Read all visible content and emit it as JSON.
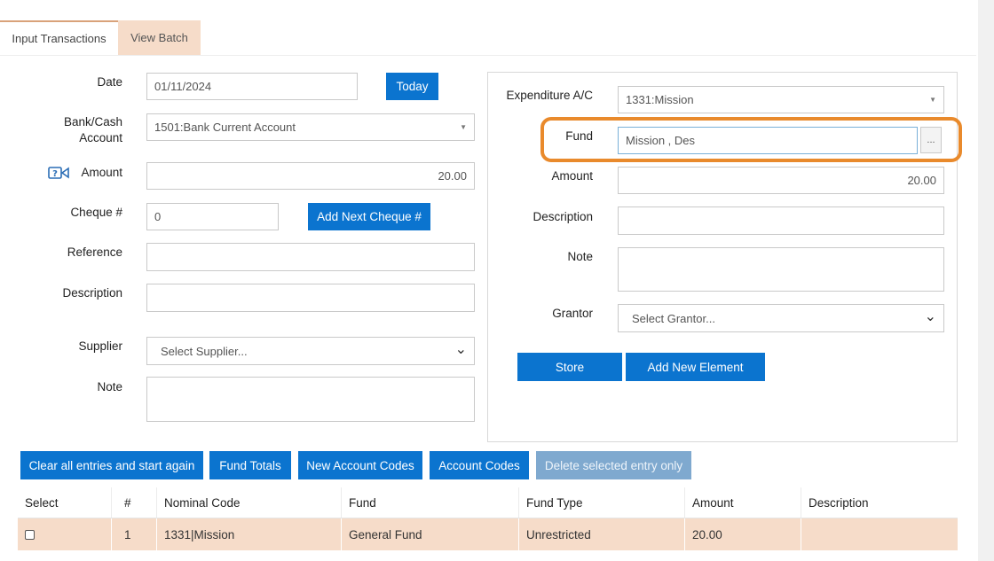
{
  "tabs": [
    {
      "label": "Input Transactions",
      "active": true
    },
    {
      "label": "View Batch",
      "active": false
    }
  ],
  "left_form": {
    "date_label": "Date",
    "date_value": "01/11/2024",
    "today_button": "Today",
    "bank_label_line1": "Bank/Cash",
    "bank_label_line2": "Account",
    "bank_value": "1501:Bank Current Account",
    "amount_label": "Amount",
    "amount_value": "20.00",
    "cheque_label": "Cheque #",
    "cheque_value": "0",
    "add_next_cheque_button": "Add Next Cheque #",
    "reference_label": "Reference",
    "description_label": "Description",
    "supplier_label": "Supplier",
    "supplier_value": "Select Supplier...",
    "note_label": "Note"
  },
  "right_form": {
    "expenditure_label": "Expenditure A/C",
    "expenditure_value": "1331:Mission",
    "fund_label": "Fund",
    "fund_value": "Mission , Des",
    "fund_lookup_button": "...",
    "amount_label": "Amount",
    "amount_value": "20.00",
    "description_label": "Description",
    "note_label": "Note",
    "grantor_label": "Grantor",
    "grantor_value": "Select Grantor...",
    "store_button": "Store",
    "add_new_element_button": "Add New Element"
  },
  "action_buttons": {
    "clear": "Clear all entries and start again",
    "fund_totals": "Fund Totals",
    "new_account_codes": "New Account Codes",
    "account_codes": "Account Codes",
    "delete_selected": "Delete selected entry only"
  },
  "table": {
    "headers": [
      "Select",
      "#",
      "Nominal Code",
      "Fund",
      "Fund Type",
      "Amount",
      "Description"
    ],
    "rows": [
      {
        "num": "1",
        "nominal_code": "1331|Mission",
        "fund": "General Fund",
        "fund_type": "Unrestricted",
        "amount": "20.00",
        "description": ""
      }
    ]
  },
  "colors": {
    "primary_button": "#0b74cf",
    "disabled_button": "#7fa9cf",
    "tab_inactive": "#f6dcc9",
    "row_highlight": "#f6dcc9",
    "highlight_ring": "#e98a2c"
  },
  "icons": {
    "amount_help": "question-video-icon",
    "select_caret": "caret-down-icon"
  }
}
